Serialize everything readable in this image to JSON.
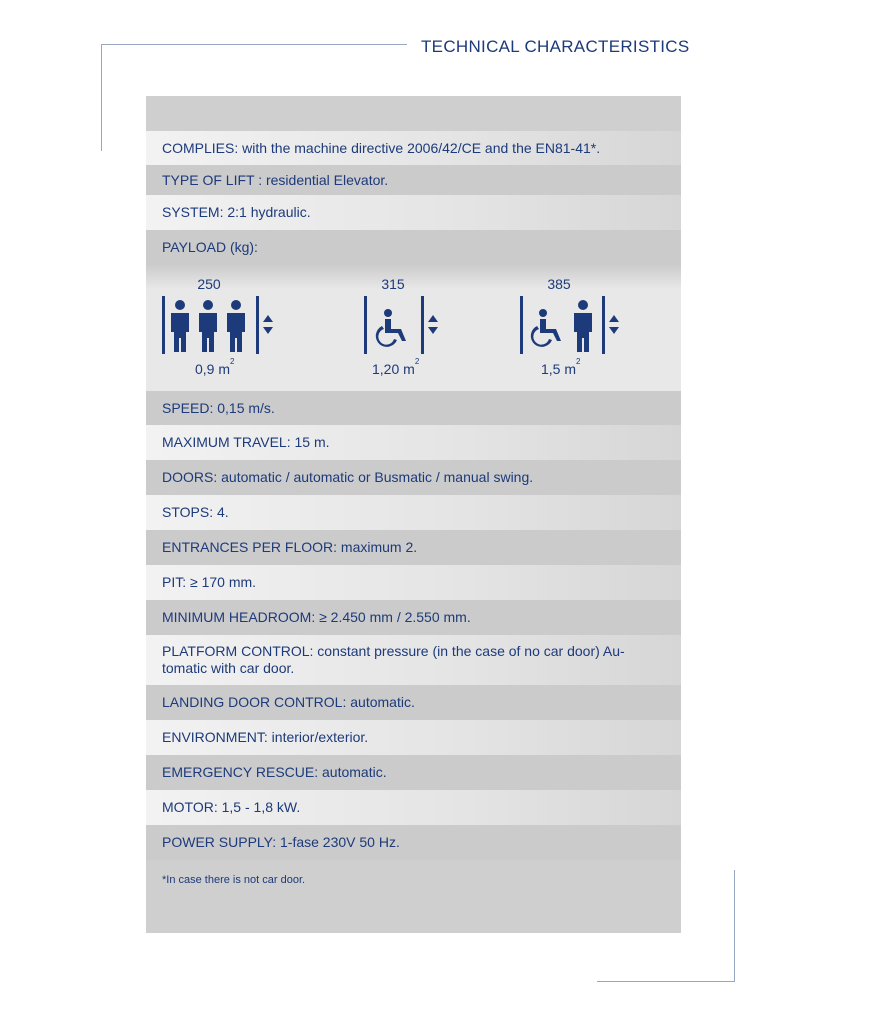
{
  "header": {
    "title": "TECHNICAL CHARACTERISTICS"
  },
  "rows": {
    "complies": "COMPLIES: with the machine directive 2006/42/CE and the EN81-41*.",
    "type": "TYPE OF LIFT : residential Elevator.",
    "system": "SYSTEM: 2:1 hydraulic.",
    "payload_label": "PAYLOAD (kg):",
    "speed": "SPEED: 0,15 m/s.",
    "travel": "MAXIMUM TRAVEL: 15 m.",
    "doors": "DOORS: automatic / automatic or Busmatic / manual swing.",
    "stops": "STOPS: 4.",
    "entrances": "ENTRANCES PER FLOOR: maximum 2.",
    "pit": "PIT: ≥ 170 mm.",
    "headroom": "MINIMUM HEADROOM: ≥ 2.450 mm / 2.550 mm.",
    "platform_line1": "PLATFORM CONTROL: constant pressure (in the case of no car door) Au-",
    "platform_line2": "tomatic with car door.",
    "landing": "LANDING DOOR CONTROL: automatic.",
    "environment": "ENVIRONMENT: interior/exterior.",
    "rescue": "EMERGENCY RESCUE: automatic.",
    "motor": "MOTOR: 1,5 - 1,8 kW.",
    "power": "POWER SUPPLY: 1-fase 230V 50 Hz."
  },
  "payload": [
    {
      "kg": "250",
      "area": "0,9 m",
      "unit_exp": "2",
      "icon": "three-persons-lift-icon"
    },
    {
      "kg": "315",
      "area": "1,20 m",
      "unit_exp": "2",
      "icon": "wheelchair-lift-icon"
    },
    {
      "kg": "385",
      "area": "1,5 m",
      "unit_exp": "2",
      "icon": "wheelchair-and-person-lift-icon"
    }
  ],
  "footnote": "*In case there is not car door.",
  "colors": {
    "text": "#1d3a7a",
    "panel": "#cfcfcf",
    "row_light": "#ececec"
  }
}
